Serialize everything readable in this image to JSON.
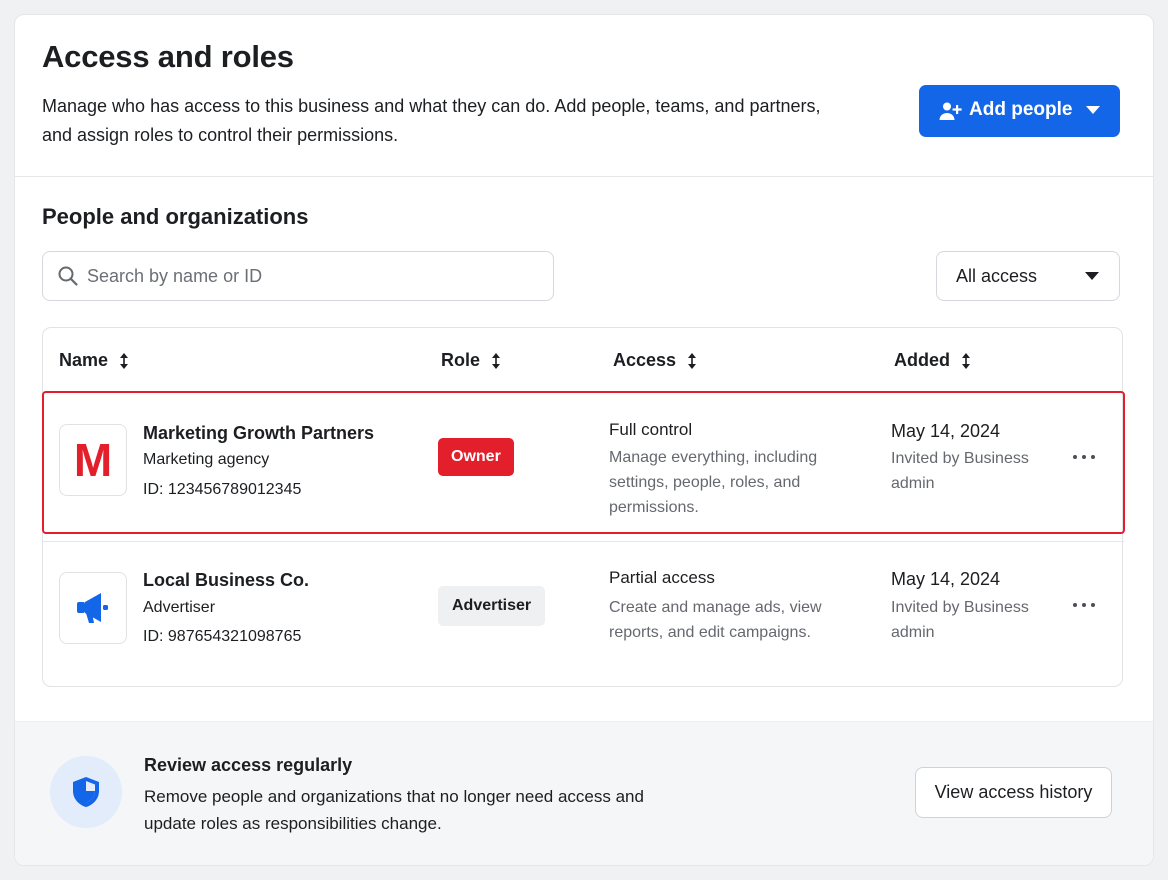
{
  "header": {
    "title": "Access and roles",
    "description": "Manage who has access to this business and what they can do. Add people, teams, and partners, and assign roles to control their permissions.",
    "add_button": {
      "label": "Add people",
      "icon": "add-person-icon"
    }
  },
  "section": {
    "title": "People and organizations",
    "search": {
      "placeholder": "Search by name or ID",
      "value": ""
    },
    "filter": {
      "selected": "All access"
    }
  },
  "table": {
    "columns": [
      {
        "label": "Name"
      },
      {
        "label": "Role"
      },
      {
        "label": "Access"
      },
      {
        "label": "Added"
      }
    ],
    "rows": [
      {
        "name": "Marketing Growth Partners",
        "type": "Marketing agency",
        "id": "ID: 123456789012345",
        "avatar_letter": "M",
        "role": "Owner",
        "access_title": "Full control",
        "access_desc": "Manage everything, including settings, people, roles, and permissions.",
        "added_date": "May 14, 2024",
        "added_by": "Invited by Business admin",
        "selected": true
      },
      {
        "name": "Local Business Co.",
        "type": "Advertiser",
        "id": "ID: 987654321098765",
        "avatar_icon": "megaphone-icon",
        "role": "Advertiser",
        "access_title": "Partial access",
        "access_desc": "Create and manage ads, view reports, and edit campaigns.",
        "added_date": "May 14, 2024",
        "added_by": "Invited by Business admin",
        "selected": false
      }
    ]
  },
  "footer": {
    "title": "Review access regularly",
    "description": "Remove people and organizations that no longer need access and update roles as responsibilities change.",
    "button": "View access history",
    "icon": "shield-icon"
  },
  "colors": {
    "primary": "#1466e8",
    "danger": "#e21f2b",
    "text": "#1c1e21",
    "muted": "#65686e"
  }
}
